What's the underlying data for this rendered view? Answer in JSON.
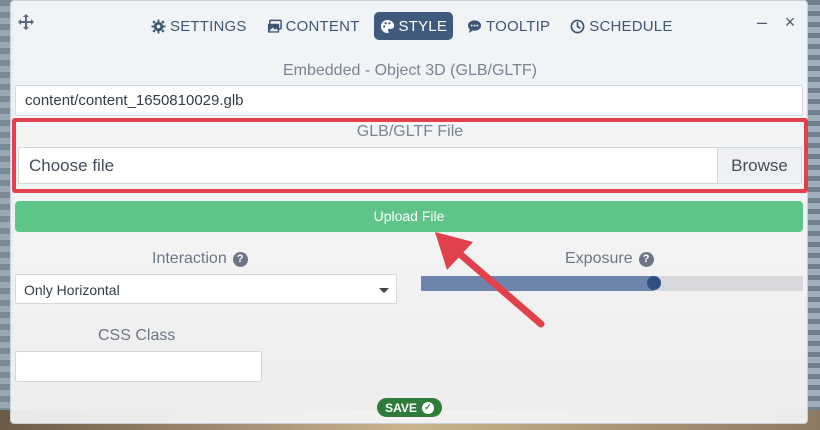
{
  "tabs": [
    {
      "label": "SETTINGS",
      "icon": "gear-icon"
    },
    {
      "label": "CONTENT",
      "icon": "images-icon"
    },
    {
      "label": "STYLE",
      "icon": "palette-icon",
      "active": true
    },
    {
      "label": "TOOLTIP",
      "icon": "comment-icon"
    },
    {
      "label": "SCHEDULE",
      "icon": "clock-icon"
    }
  ],
  "window": {
    "minimize": "–",
    "close": "×"
  },
  "form": {
    "title": "Embedded - Object 3D (GLB/GLTF)",
    "content_path": "content/content_1650810029.glb",
    "file_label": "GLB/GLTF File",
    "file_placeholder": "Choose file",
    "browse_label": "Browse",
    "upload_label": "Upload File",
    "interaction_label": "Interaction",
    "interaction_value": "Only Horizontal",
    "exposure_label": "Exposure",
    "exposure_value": 0.61,
    "css_class_label": "CSS Class",
    "css_class_value": "",
    "save_label": "SAVE"
  },
  "colors": {
    "accent": "#3f5a7c",
    "upload": "#5ec489",
    "save": "#2f7b3c",
    "highlight": "#e0414b"
  }
}
